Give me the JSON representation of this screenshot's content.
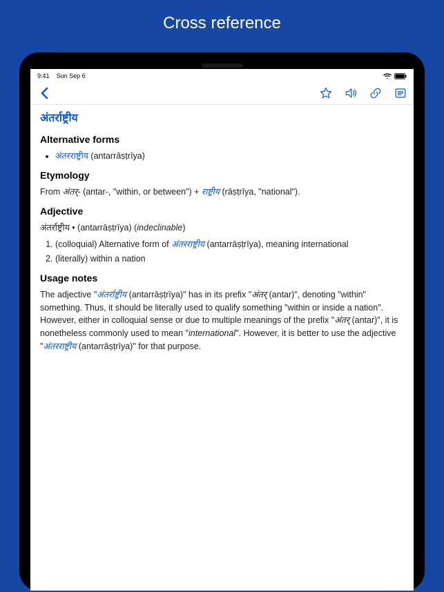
{
  "page": {
    "title": "Cross reference"
  },
  "status": {
    "time": "9:41",
    "date": "Sun Sep 6"
  },
  "icons": {
    "back": "back-chevron",
    "star": "star-icon",
    "speaker": "speaker-icon",
    "link": "link-icon",
    "note": "note-icon",
    "wifi": "wifi-icon",
    "battery": "battery-icon"
  },
  "entry": {
    "headword": "अंतर्राष्ट्रीय",
    "sections": {
      "altforms": {
        "heading": "Alternative forms",
        "items": [
          {
            "link": "अंतरराष्ट्रीय",
            "romanization": " (antarrāṣṭrīya)"
          }
        ]
      },
      "etymology": {
        "heading": "Etymology",
        "prefix": "From ",
        "root1": "अंतर्-",
        "root1_gloss": " (antar-, \"within, or between\") + ",
        "root2": "राष्ट्रीय",
        "root2_gloss": " (rāṣṭrīya, \"national\")."
      },
      "adjective": {
        "heading": "Adjective",
        "headline_word": "अंतर्राष्ट्रीय",
        "headline_rest": " • (antarrāṣṭrīya) (",
        "headline_italic": "indeclinable",
        "headline_close": ")",
        "senses": [
          {
            "pre": "(colloquial) Alternative form of ",
            "link": "अंतरराष्ट्रीय",
            "post": " (antarrāṣṭrīya), meaning international"
          },
          {
            "pre": "(literally) within a nation",
            "link": "",
            "post": ""
          }
        ]
      },
      "usage": {
        "heading": "Usage notes",
        "t1": "The adjective \"",
        "link1": "अंतर्राष्ट्रीय",
        "t2": " (antarrāṣṭrīya)\" has in its prefix \"",
        "i1": "अंतर्",
        "t3": " (antar)\", denoting \"within\" something. Thus, it should be literally used to qualify something \"within or inside a nation\". However, either in colloquial sense or due to multiple meanings of the prefix \"",
        "i2": "अंतर्",
        "t4": " (antar)\", it is nonetheless commonly used to mean \"",
        "i3": "international",
        "t5": "\". However, it is better to use the adjective \"",
        "link2": "अंतरराष्ट्रीय",
        "t6": " (antarrāṣṭrīya)\" for that purpose."
      }
    }
  }
}
